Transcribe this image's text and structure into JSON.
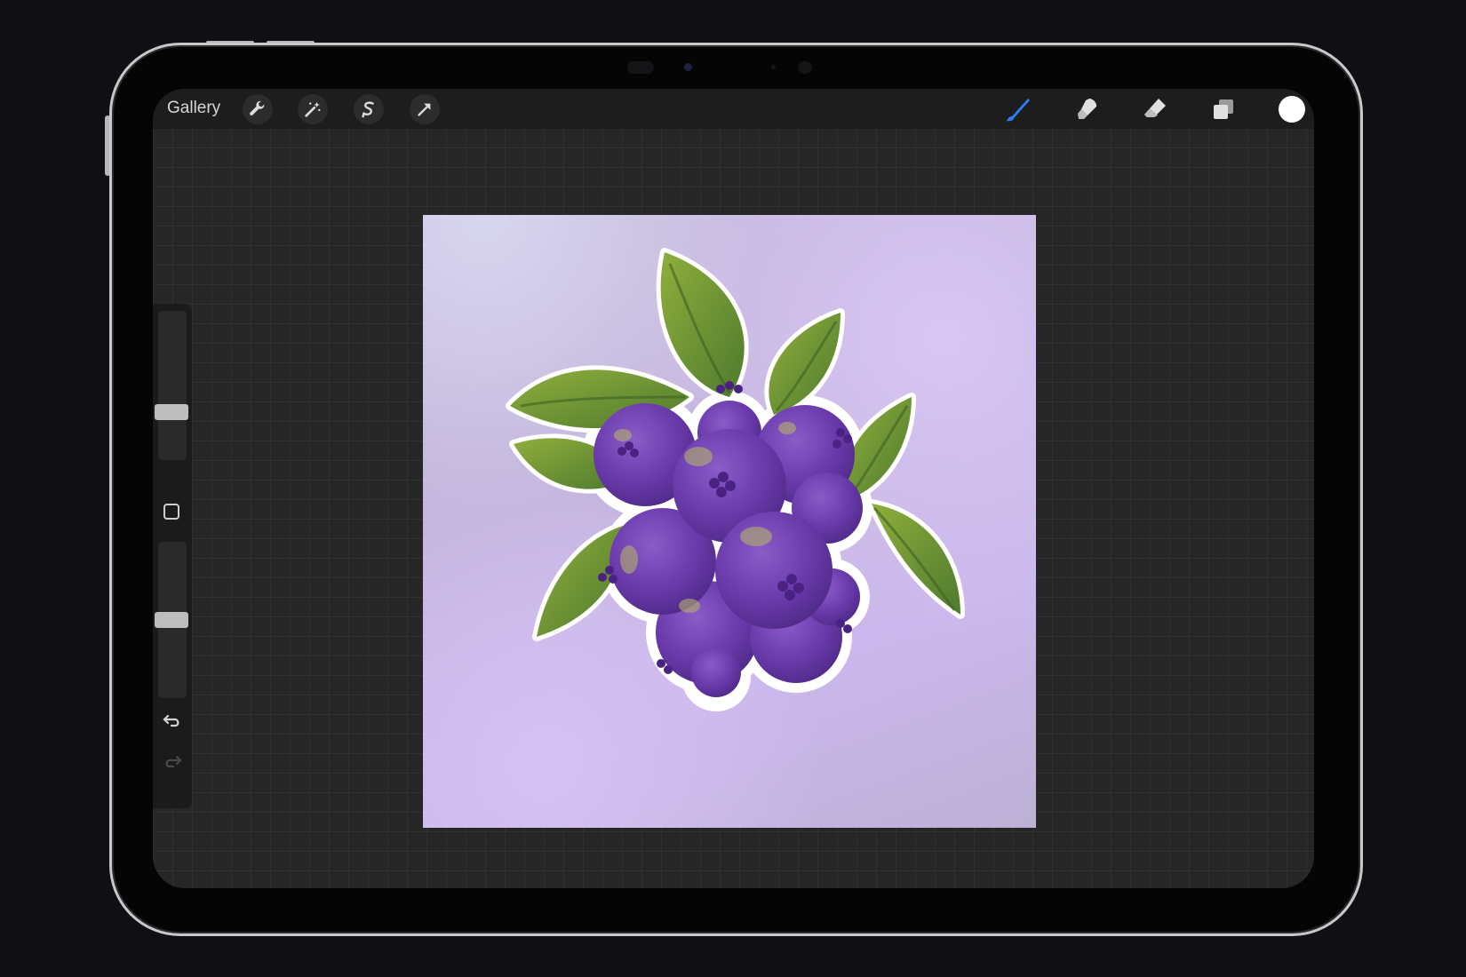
{
  "toolbar": {
    "gallery_label": "Gallery",
    "left_tools": [
      "wrench-icon",
      "magic-wand-icon",
      "selection-icon",
      "transform-arrow-icon"
    ],
    "right_tools": [
      "brush-icon",
      "smudge-icon",
      "eraser-icon",
      "layers-icon"
    ],
    "current_color": "#ffffff",
    "brush_accent": "#2f7cf6"
  },
  "sidebar": {
    "size_slider_level": 0.3,
    "opacity_slider_level": 0.5
  },
  "artwork": {
    "subject": "blueberry-cluster-illustration",
    "background_color": "#c8b8e6",
    "berry_color": "#6d3fae",
    "leaf_color": "#6f9a3a"
  }
}
